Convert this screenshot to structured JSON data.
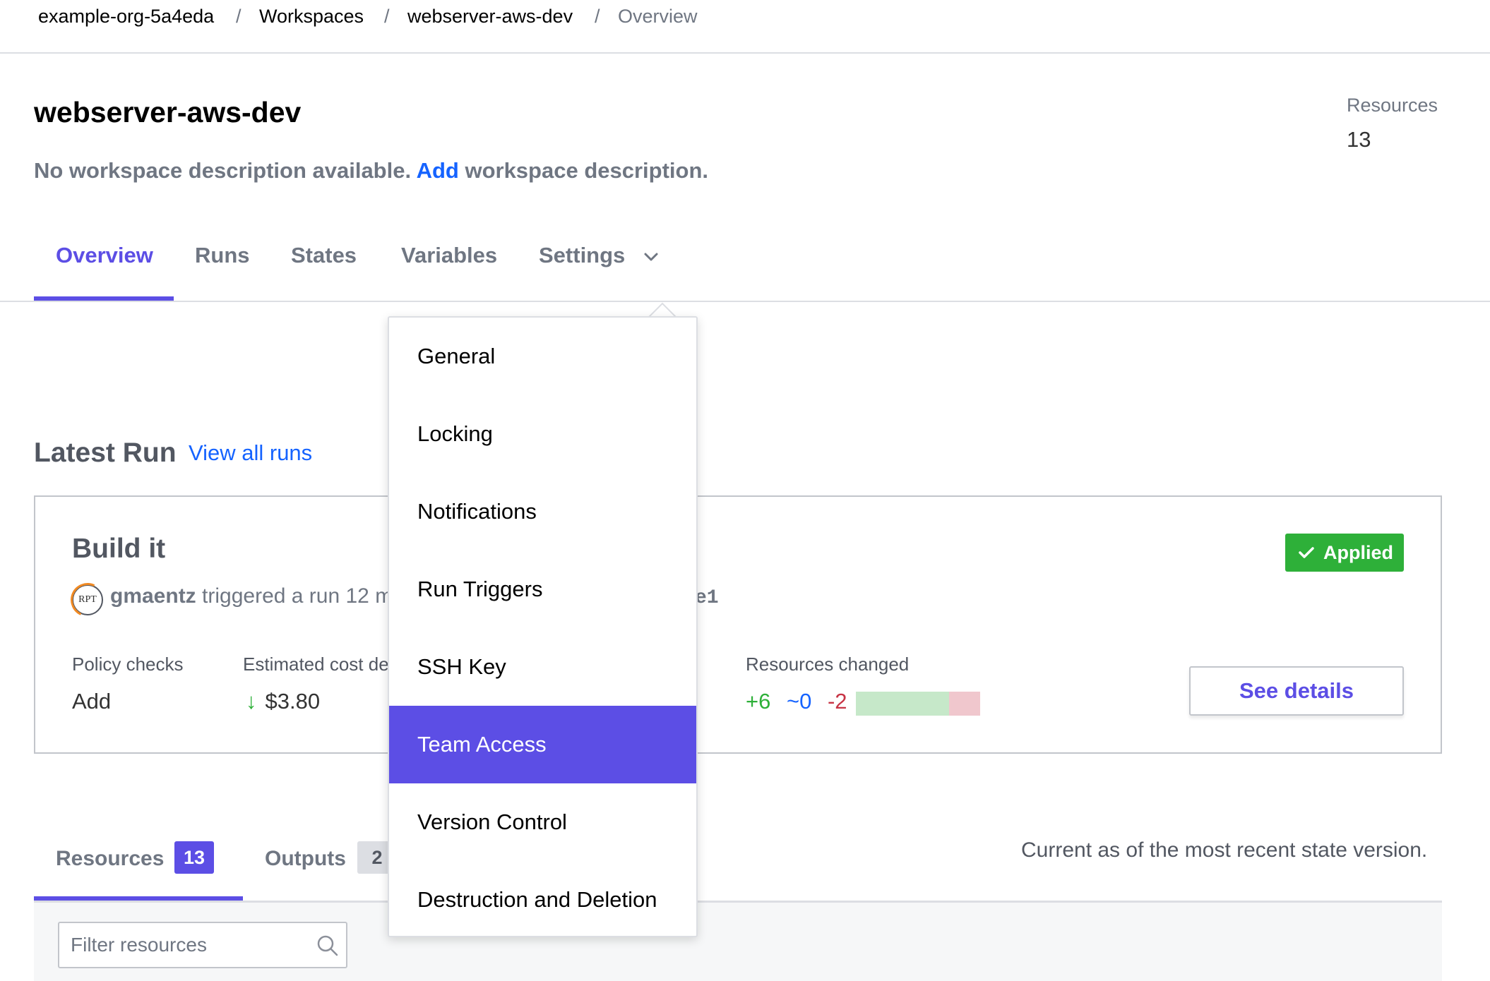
{
  "breadcrumb": {
    "org": "example-org-5a4eda",
    "workspaces": "Workspaces",
    "workspace": "webserver-aws-dev",
    "current": "Overview",
    "separator": "/"
  },
  "header": {
    "title": "webserver-aws-dev",
    "description_prefix": "No workspace description available.",
    "description_link": "Add",
    "description_suffix": "workspace description.",
    "resources_label": "Resources",
    "resources_count": "13"
  },
  "tabs": [
    {
      "label": "Overview",
      "active": true
    },
    {
      "label": "Runs"
    },
    {
      "label": "States"
    },
    {
      "label": "Variables"
    },
    {
      "label": "Settings"
    }
  ],
  "latest_run": {
    "title": "Latest Run",
    "view_all": "View all runs",
    "run_name": "Build it",
    "avatar_text": "RPT",
    "user": "gmaentz",
    "trigger_text": "triggered a run 12 m",
    "tail_text": "e1",
    "status": "Applied",
    "policy_label": "Policy checks",
    "policy_value": "Add",
    "cost_label": "Estimated cost de",
    "cost_arrow": "↓",
    "cost_value": "$3.80",
    "changed_label": "Resources changed",
    "changed_add": "+6",
    "changed_mod": "~0",
    "changed_del": "-2",
    "see_details": "See details"
  },
  "lower_tabs": {
    "resources_label": "Resources",
    "resources_count": "13",
    "outputs_label": "Outputs",
    "outputs_count": "2",
    "note": "Current as of the most recent state version."
  },
  "filter": {
    "placeholder": "Filter resources"
  },
  "settings_menu": {
    "items": [
      {
        "label": "General"
      },
      {
        "label": "Locking"
      },
      {
        "label": "Notifications"
      },
      {
        "label": "Run Triggers"
      },
      {
        "label": "SSH Key"
      },
      {
        "label": "Team Access",
        "selected": true
      },
      {
        "label": "Version Control"
      },
      {
        "label": "Destruction and Deletion"
      }
    ]
  },
  "colors": {
    "accent": "#5c4ee5",
    "link": "#1563ff",
    "success": "#2eb039",
    "danger": "#c73445"
  },
  "icons": [
    "chevron-down-icon",
    "check-icon",
    "arrow-down-icon",
    "search-icon"
  ]
}
